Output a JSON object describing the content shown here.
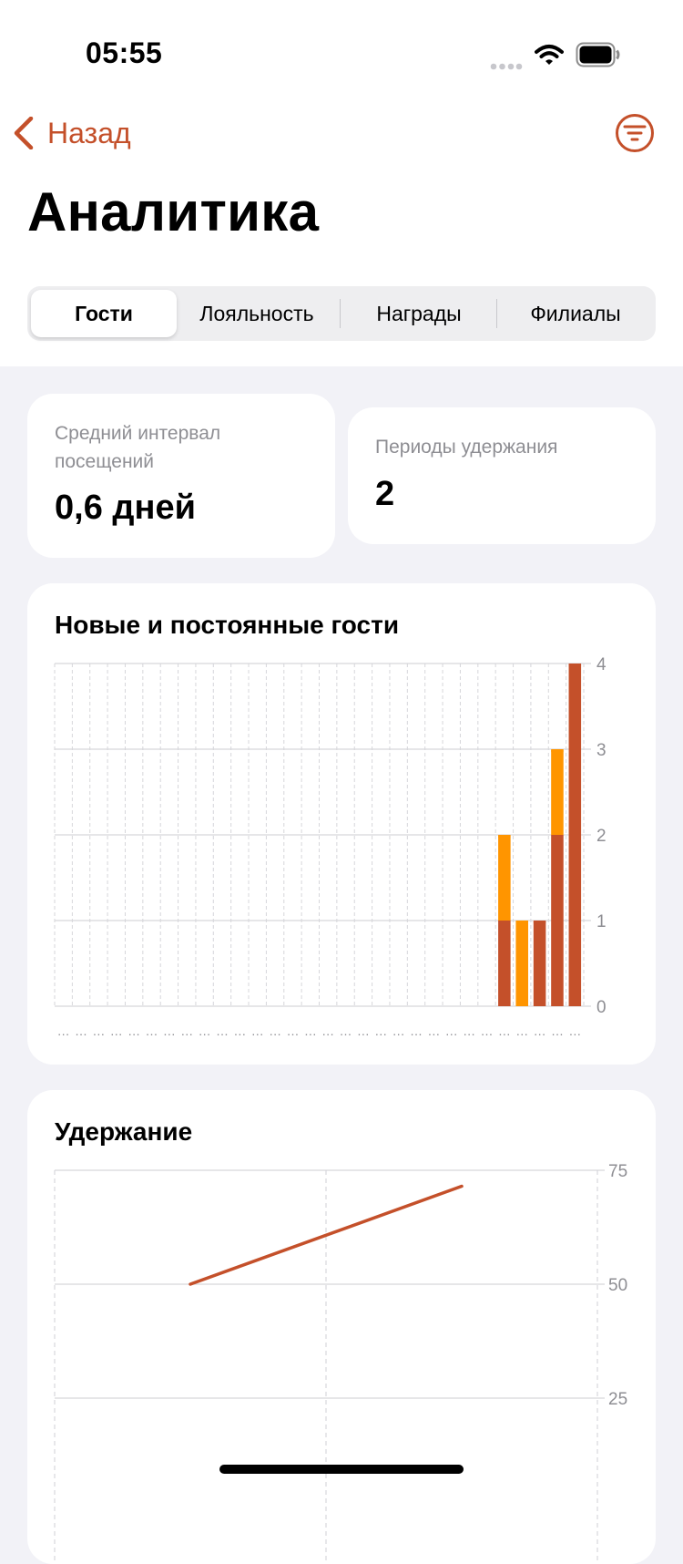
{
  "status_bar": {
    "time": "05:55"
  },
  "nav": {
    "back_label": "Назад"
  },
  "page": {
    "title": "Аналитика"
  },
  "tabs": [
    {
      "label": "Гости",
      "active": true
    },
    {
      "label": "Лояльность",
      "active": false
    },
    {
      "label": "Награды",
      "active": false
    },
    {
      "label": "Филиалы",
      "active": false
    }
  ],
  "stats": {
    "avg_interval": {
      "label": "Средний интервал посещений",
      "value": "0,6 дней"
    },
    "retention_periods": {
      "label": "Периоды удержания",
      "value": "2"
    }
  },
  "colors": {
    "accent": "#C4502A",
    "secondary": "#FF9500",
    "background": "#F2F2F7"
  },
  "chart_data": [
    {
      "type": "bar",
      "stacked": true,
      "title": "Новые и постоянные гости",
      "category_count": 30,
      "series": [
        {
          "values": [
            0,
            0,
            0,
            0,
            0,
            0,
            0,
            0,
            0,
            0,
            0,
            0,
            0,
            0,
            0,
            0,
            0,
            0,
            0,
            0,
            0,
            0,
            0,
            0,
            0,
            1,
            0,
            1,
            2,
            4
          ],
          "color": "#C4502A"
        },
        {
          "values": [
            0,
            0,
            0,
            0,
            0,
            0,
            0,
            0,
            0,
            0,
            0,
            0,
            0,
            0,
            0,
            0,
            0,
            0,
            0,
            0,
            0,
            0,
            0,
            0,
            0,
            1,
            1,
            0,
            1,
            0
          ],
          "color": "#FF9500"
        }
      ],
      "ylim": [
        0,
        4
      ],
      "yticks": [
        "0",
        "1",
        "2",
        "3",
        "4"
      ],
      "x_tick_labels": "…",
      "grid": true
    },
    {
      "type": "line",
      "title": "Удержание",
      "x": [
        1,
        2
      ],
      "xlim": [
        0.5,
        2.5
      ],
      "values": [
        50,
        71.5
      ],
      "ylim": [
        25,
        75
      ],
      "yticks": [
        "75",
        "50",
        "25"
      ],
      "grid": true,
      "color": "#C4502A"
    }
  ]
}
